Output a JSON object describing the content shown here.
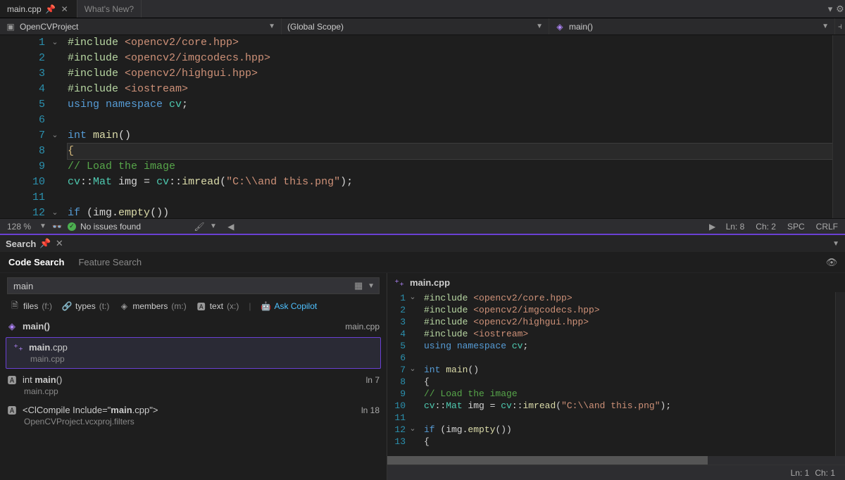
{
  "tabs": {
    "active": "main.cpp",
    "inactive": "What's New?"
  },
  "toolbar": {
    "project": "OpenCVProject",
    "scope": "(Global Scope)",
    "method": "main()"
  },
  "editor": {
    "lines": [
      {
        "n": 1,
        "fold": "v",
        "tokens": [
          {
            "t": "#include ",
            "c": "gd"
          },
          {
            "t": "<opencv2/core.hpp>",
            "c": "inc"
          }
        ]
      },
      {
        "n": 2,
        "tokens": [
          {
            "t": "#include ",
            "c": "gd"
          },
          {
            "t": "<opencv2/imgcodecs.hpp>",
            "c": "inc"
          }
        ]
      },
      {
        "n": 3,
        "tokens": [
          {
            "t": "#include ",
            "c": "gd"
          },
          {
            "t": "<opencv2/highgui.hpp>",
            "c": "inc"
          }
        ]
      },
      {
        "n": 4,
        "tokens": [
          {
            "t": "#include ",
            "c": "gd"
          },
          {
            "t": "<iostream>",
            "c": "inc"
          }
        ]
      },
      {
        "n": 5,
        "tokens": [
          {
            "t": "using ",
            "c": "kw"
          },
          {
            "t": "namespace ",
            "c": "kw"
          },
          {
            "t": "cv",
            "c": "ty"
          },
          {
            "t": ";",
            "c": "pun"
          }
        ]
      },
      {
        "n": 6,
        "tokens": []
      },
      {
        "n": 7,
        "fold": "v",
        "tokens": [
          {
            "t": "int ",
            "c": "kw"
          },
          {
            "t": "main",
            "c": "fn"
          },
          {
            "t": "()",
            "c": "pun"
          }
        ]
      },
      {
        "n": 8,
        "hl": true,
        "tokens": [
          {
            "t": "{",
            "c": "light-str"
          }
        ]
      },
      {
        "n": 9,
        "indent": 1,
        "tokens": [
          {
            "t": "// Load the image",
            "c": "cm"
          }
        ]
      },
      {
        "n": 10,
        "indent": 1,
        "tokens": [
          {
            "t": "cv",
            "c": "ty"
          },
          {
            "t": "::",
            "c": "pun"
          },
          {
            "t": "Mat",
            "c": "ty"
          },
          {
            "t": " img = ",
            "c": "pun"
          },
          {
            "t": "cv",
            "c": "ty"
          },
          {
            "t": "::",
            "c": "pun"
          },
          {
            "t": "imread",
            "c": "fn"
          },
          {
            "t": "(",
            "c": "pun"
          },
          {
            "t": "\"C:\\\\and this.png\"",
            "c": "str"
          },
          {
            "t": ");",
            "c": "pun"
          }
        ]
      },
      {
        "n": 11,
        "indent": 1,
        "tokens": []
      },
      {
        "n": 12,
        "fold": "v",
        "indent": 1,
        "tokens": [
          {
            "t": "if ",
            "c": "kw"
          },
          {
            "t": "(img",
            "c": "pun"
          },
          {
            "t": ".",
            "c": "pun"
          },
          {
            "t": "empty",
            "c": "fn"
          },
          {
            "t": "())",
            "c": "pun"
          }
        ]
      }
    ]
  },
  "status": {
    "zoom": "128 %",
    "issues": "No issues found",
    "ln": "Ln: 8",
    "ch": "Ch: 2",
    "spc": "SPC",
    "crlf": "CRLF"
  },
  "search": {
    "panel_title": "Search",
    "tab_code": "Code Search",
    "tab_feature": "Feature Search",
    "query": "main",
    "filters": {
      "files": "files",
      "files_hint": "(f:)",
      "types": "types",
      "types_hint": "(t:)",
      "members": "members",
      "members_hint": "(m:)",
      "text": "text",
      "text_hint": "(x:)",
      "copilot": "Ask Copilot"
    },
    "results": [
      {
        "icon": "cube",
        "label": "main()",
        "right": "main.cpp",
        "path": ""
      },
      {
        "icon": "cpp",
        "label": "main.cpp",
        "bold_part": "main",
        "right": "",
        "path": "main.cpp",
        "selected": true
      },
      {
        "icon": "abl",
        "label": "int main()",
        "bold_part": "main",
        "right": "ln 7",
        "path": "main.cpp"
      },
      {
        "icon": "abl",
        "label": "<ClCompile Include=\"main.cpp\">",
        "bold_part": "main",
        "right": "ln 18",
        "path": "OpenCVProject.vcxproj.filters"
      }
    ],
    "preview": {
      "file": "main.cpp",
      "lines": [
        {
          "n": 1,
          "fold": "v",
          "tokens": [
            {
              "t": "#include ",
              "c": "gd"
            },
            {
              "t": "<opencv2/core.hpp>",
              "c": "inc"
            }
          ]
        },
        {
          "n": 2,
          "tokens": [
            {
              "t": "#include ",
              "c": "gd"
            },
            {
              "t": "<opencv2/imgcodecs.hpp>",
              "c": "inc"
            }
          ]
        },
        {
          "n": 3,
          "tokens": [
            {
              "t": "#include ",
              "c": "gd"
            },
            {
              "t": "<opencv2/highgui.hpp>",
              "c": "inc"
            }
          ]
        },
        {
          "n": 4,
          "tokens": [
            {
              "t": "#include ",
              "c": "gd"
            },
            {
              "t": "<iostream>",
              "c": "inc"
            }
          ]
        },
        {
          "n": 5,
          "tokens": [
            {
              "t": "using ",
              "c": "kw"
            },
            {
              "t": "namespace ",
              "c": "kw"
            },
            {
              "t": "cv",
              "c": "ty"
            },
            {
              "t": ";",
              "c": "pun"
            }
          ]
        },
        {
          "n": 6,
          "tokens": []
        },
        {
          "n": 7,
          "fold": "v",
          "tokens": [
            {
              "t": "int ",
              "c": "kw"
            },
            {
              "t": "main",
              "c": "fn"
            },
            {
              "t": "()",
              "c": "pun"
            }
          ]
        },
        {
          "n": 8,
          "indent": 1,
          "tokens": [
            {
              "t": "{",
              "c": "pun"
            }
          ]
        },
        {
          "n": 9,
          "indent": 2,
          "tokens": [
            {
              "t": "// Load the image",
              "c": "cm"
            }
          ]
        },
        {
          "n": 10,
          "indent": 2,
          "tokens": [
            {
              "t": "cv",
              "c": "ty"
            },
            {
              "t": "::",
              "c": "pun"
            },
            {
              "t": "Mat",
              "c": "ty"
            },
            {
              "t": " img = ",
              "c": "pun"
            },
            {
              "t": "cv",
              "c": "ty"
            },
            {
              "t": "::",
              "c": "pun"
            },
            {
              "t": "imread",
              "c": "fn"
            },
            {
              "t": "(",
              "c": "pun"
            },
            {
              "t": "\"C:\\\\and this.png\"",
              "c": "str"
            },
            {
              "t": ");",
              "c": "pun"
            }
          ]
        },
        {
          "n": 11,
          "indent": 2,
          "tokens": []
        },
        {
          "n": 12,
          "fold": "v",
          "indent": 2,
          "tokens": [
            {
              "t": "if ",
              "c": "kw"
            },
            {
              "t": "(img.",
              "c": "pun"
            },
            {
              "t": "empty",
              "c": "fn"
            },
            {
              "t": "())",
              "c": "pun"
            }
          ]
        },
        {
          "n": 13,
          "indent": 2,
          "tokens": [
            {
              "t": "{",
              "c": "pun"
            }
          ]
        }
      ],
      "status_ln": "Ln: 1",
      "status_ch": "Ch: 1"
    }
  }
}
